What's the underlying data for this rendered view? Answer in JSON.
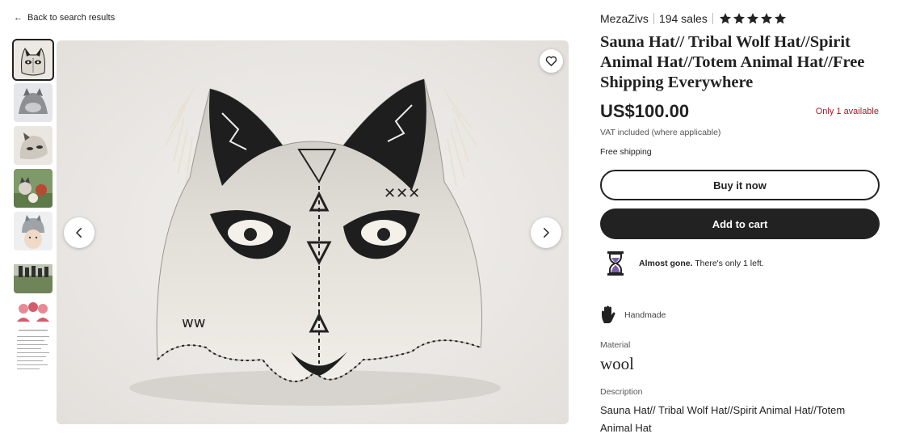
{
  "nav": {
    "back_label": "Back to search results"
  },
  "shop": {
    "name": "MezaZivs",
    "sales": "194 sales",
    "rating_stars": 5
  },
  "listing": {
    "title": "Sauna Hat// Tribal Wolf Hat//Spirit Animal Hat//Totem Animal Hat//Free Shipping Everywhere",
    "price": "US$100.00",
    "availability": "Only 1 available",
    "vat_note": "VAT included (where applicable)",
    "shipping": "Free shipping"
  },
  "actions": {
    "buy_now": "Buy it now",
    "add_to_cart": "Add to cart"
  },
  "notice": {
    "bold": "Almost gone.",
    "text": " There's only 1 left."
  },
  "details": {
    "handmade": "Handmade",
    "material_label": "Material",
    "material_value": "wool",
    "description_label": "Description",
    "description_value": "Sauna Hat// Tribal Wolf Hat//Spirit Animal Hat//Totem Animal Hat"
  },
  "icons": {
    "back": "arrow-left-icon",
    "favorite": "heart-icon",
    "prev": "chevron-left-icon",
    "next": "chevron-right-icon",
    "star": "star-icon",
    "hourglass": "hourglass-icon",
    "handmade": "hand-icon"
  },
  "colors": {
    "accent_dark": "#222222",
    "availability": "#a61a2e",
    "hourglass": "#7b61a8"
  }
}
